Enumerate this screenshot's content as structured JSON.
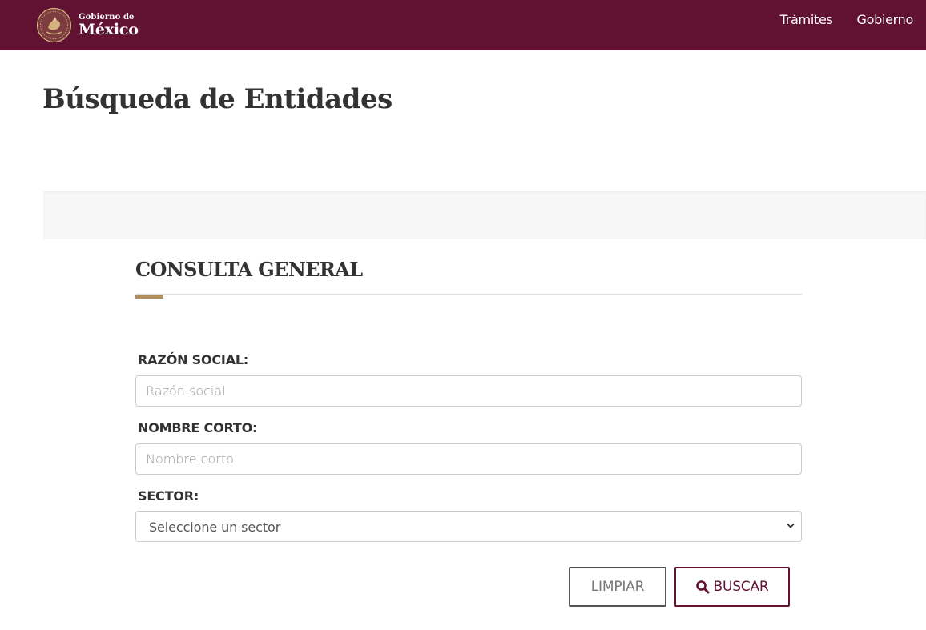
{
  "header": {
    "logo_small": "Gobierno de",
    "logo_big": "México",
    "nav": [
      "Trámites",
      "Gobierno"
    ]
  },
  "page": {
    "title": "Búsqueda de Entidades"
  },
  "form": {
    "section_title": "CONSULTA GENERAL",
    "razon_social_label": "RAZÓN SOCIAL:",
    "razon_social_placeholder": "Razón social",
    "razon_social_value": "",
    "nombre_corto_label": "NOMBRE CORTO:",
    "nombre_corto_placeholder": "Nombre corto",
    "nombre_corto_value": "",
    "sector_label": "SECTOR:",
    "sector_selected": "Seleccione un sector",
    "clear_label": "LIMPIAR",
    "search_label": "BUSCAR"
  },
  "colors": {
    "brand": "#611232",
    "accent": "#b38e5d",
    "text": "#333333"
  },
  "icons": {
    "seal": "mexico-seal-icon",
    "search": "search-icon",
    "chevron": "chevron-down-icon"
  }
}
